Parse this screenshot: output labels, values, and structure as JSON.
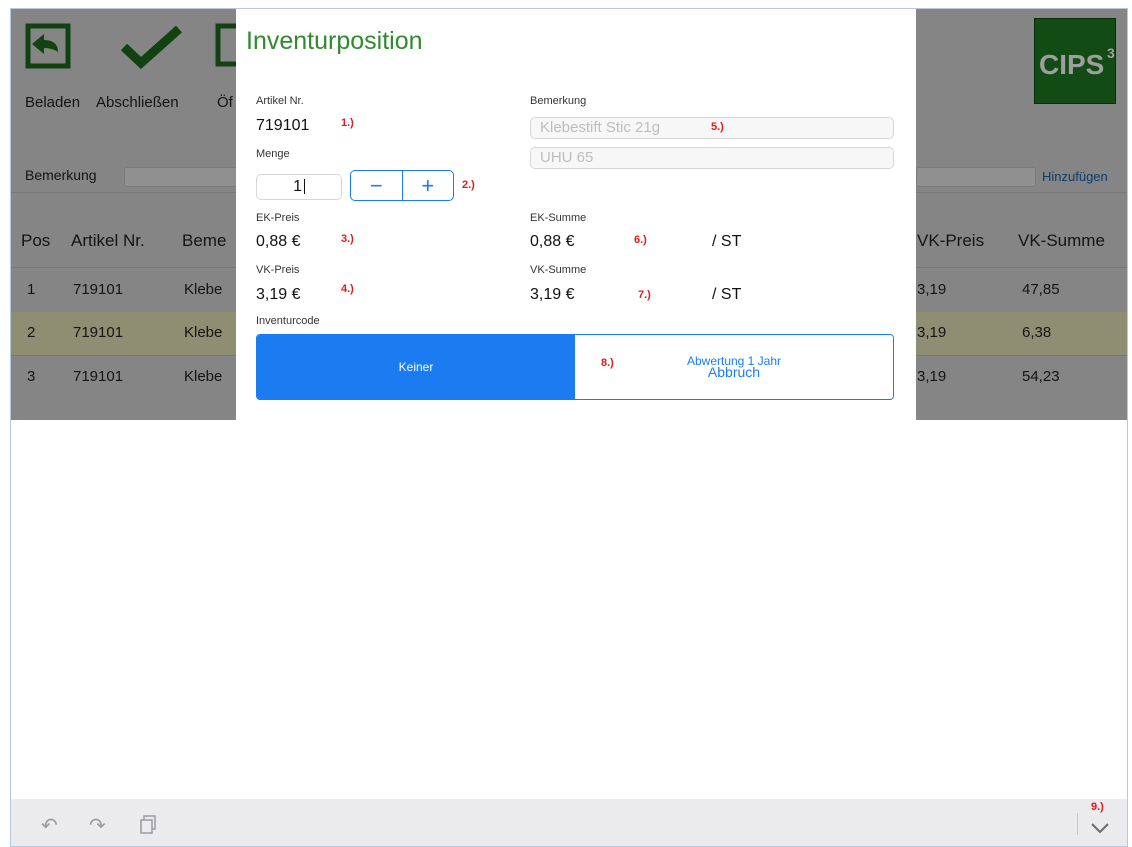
{
  "toolbar": {
    "beladen_label": "Beladen",
    "abschliessen_label": "Abschließen",
    "oeffnen_label_cut": "Öf",
    "logo_text": "CIPS",
    "logo_sup": "3"
  },
  "background": {
    "bemerkung_label": "Bemerkung",
    "hinzufuegen_label": "Hinzufügen",
    "table": {
      "headers": [
        "Pos",
        "Artikel Nr.",
        "Beme",
        "VK-Preis",
        "VK-Summe"
      ],
      "rows": [
        {
          "pos": "1",
          "artikel": "719101",
          "beme": "Klebe",
          "vk_preis": "3,19",
          "vk_summe": "47,85"
        },
        {
          "pos": "2",
          "artikel": "719101",
          "beme": "Klebe",
          "vk_preis": "3,19",
          "vk_summe": "6,38"
        },
        {
          "pos": "3",
          "artikel": "719101",
          "beme": "Klebe",
          "vk_preis": "3,19",
          "vk_summe": "54,23"
        }
      ]
    }
  },
  "modal": {
    "title": "Inventurposition",
    "artikel_label": "Artikel Nr.",
    "artikel_value": "719101",
    "menge_label": "Menge",
    "menge_value": "1",
    "stepper_minus": "−",
    "stepper_plus": "+",
    "ek_preis_label": "EK-Preis",
    "ek_preis_value": "0,88 €",
    "vk_preis_label": "VK-Preis",
    "vk_preis_value": "3,19 €",
    "bemerkung_label": "Bemerkung",
    "bemerkung_line1": "Klebestift Stic 21g",
    "bemerkung_line2": "UHU 65",
    "ek_summe_label": "EK-Summe",
    "ek_summe_value": "0,88 €",
    "ek_summe_unit": "/ ST",
    "vk_summe_label": "VK-Summe",
    "vk_summe_value": "3,19 €",
    "vk_summe_unit": "/ ST",
    "inventurcode_label": "Inventurcode",
    "code_option_selected": "Keiner",
    "code_option_other": "Abwertung 1 Jahr",
    "abbruch_label": "Abbruch"
  },
  "annotations": {
    "a1": "1.)",
    "a2": "2.)",
    "a3": "3.)",
    "a4": "4.)",
    "a5": "5.)",
    "a6": "6.)",
    "a7": "7.)",
    "a8": "8.)",
    "a9": "9.)"
  },
  "bottombar": {
    "undo_icon": "undo-icon",
    "redo_icon": "redo-icon",
    "clipboard_icon": "clipboard-icon",
    "chevron_icon": "chevron-down-icon"
  },
  "colors": {
    "accent": "#1a7cf0",
    "title_green": "#2e8b2e",
    "annotation_red": "#d81e1e"
  }
}
